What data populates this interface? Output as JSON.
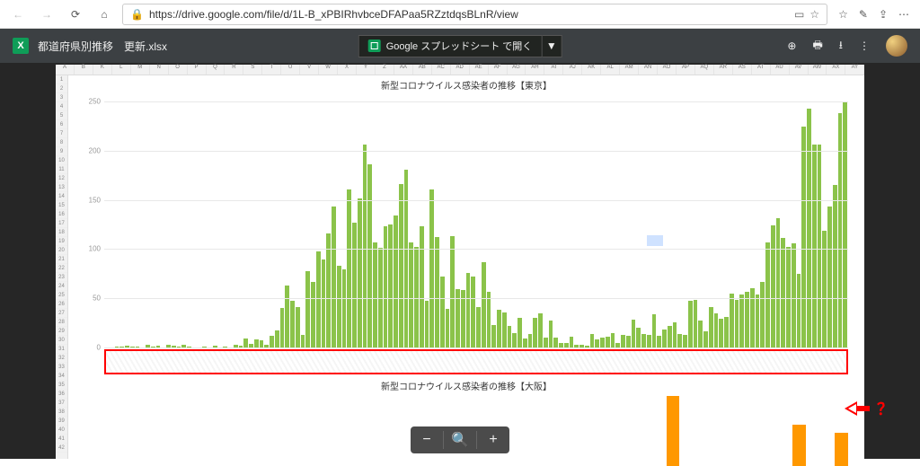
{
  "browser": {
    "url": "https://drive.google.com/file/d/1L-B_xPBIRhvbceDFAPaa5RZztdqsBLnR/view"
  },
  "drive": {
    "filename": "都道府県別推移　更新.xlsx",
    "file_badge": "X",
    "open_with": "Google スプレッドシート で開く"
  },
  "sheet": {
    "columns": [
      "A",
      "B",
      "K",
      "L",
      "M",
      "N",
      "O",
      "P",
      "Q",
      "R",
      "S",
      "T",
      "U",
      "V",
      "W",
      "X",
      "Y",
      "Z",
      "AA",
      "AB",
      "AC",
      "AD",
      "AE",
      "AF",
      "AG",
      "AH",
      "AI",
      "AJ",
      "AK",
      "AL",
      "AM",
      "AN",
      "AO",
      "AP",
      "AQ",
      "AR",
      "AS",
      "AT",
      "AU",
      "AV",
      "AW",
      "AX",
      "AY"
    ]
  },
  "chart_data": [
    {
      "type": "bar",
      "title": "新型コロナウイルス感染者の推移【東京】",
      "ylabel": "",
      "xlabel": "",
      "ylim": [
        0,
        260
      ],
      "yticks": [
        0,
        50,
        100,
        150,
        200,
        250
      ],
      "color": "#8bc34a",
      "highlight_index": 105,
      "values": [
        0,
        0,
        1,
        1,
        2,
        1,
        1,
        0,
        3,
        1,
        2,
        0,
        3,
        2,
        1,
        3,
        1,
        0,
        0,
        1,
        0,
        2,
        0,
        1,
        0,
        3,
        2,
        9,
        4,
        8,
        7,
        3,
        12,
        17,
        40,
        63,
        47,
        41,
        13,
        78,
        67,
        98,
        89,
        116,
        143,
        83,
        79,
        161,
        127,
        151,
        206,
        186,
        107,
        101,
        123,
        125,
        134,
        166,
        181,
        107,
        102,
        123,
        47,
        161,
        112,
        72,
        39,
        113,
        59,
        58,
        76,
        72,
        41,
        87,
        57,
        23,
        38,
        36,
        22,
        15,
        30,
        9,
        14,
        30,
        35,
        10,
        27,
        10,
        5,
        5,
        11,
        3,
        3,
        2,
        14,
        8,
        10,
        11,
        15,
        5,
        13,
        12,
        28,
        20,
        14,
        13,
        34,
        12,
        18,
        22,
        26,
        14,
        13,
        47,
        48,
        27,
        16,
        41,
        35,
        29,
        31,
        55,
        48,
        54,
        57,
        60,
        54,
        67,
        107,
        124,
        131,
        111,
        102,
        106,
        75,
        224,
        243,
        206,
        206,
        119,
        143,
        165,
        238,
        250
      ]
    },
    {
      "type": "bar",
      "title": "新型コロナウイルス感染者の推移【大阪】",
      "ylim": [
        0,
        90
      ],
      "color": "#ff9800",
      "values": [
        0,
        0,
        0,
        0,
        0,
        0,
        0,
        0,
        0,
        0,
        0,
        0,
        0,
        0,
        0,
        0,
        0,
        0,
        0,
        0,
        0,
        0,
        0,
        0,
        0,
        0,
        0,
        0,
        0,
        0,
        0,
        0,
        0,
        0,
        0,
        0,
        0,
        0,
        0,
        0,
        88,
        0,
        0,
        0,
        0,
        0,
        0,
        0,
        0,
        52,
        0,
        0,
        42
      ]
    }
  ],
  "annotation": {
    "mark": "？"
  },
  "zoom": {
    "minus": "−",
    "plus": "+"
  }
}
